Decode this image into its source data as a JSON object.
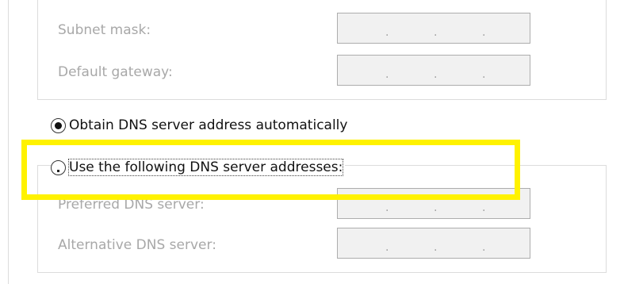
{
  "ip_settings": {
    "subnet_mask": {
      "label": "Subnet mask:",
      "octets": [
        ".",
        ".",
        "."
      ]
    },
    "default_gateway": {
      "label": "Default gateway:",
      "octets": [
        ".",
        ".",
        "."
      ]
    }
  },
  "dns": {
    "obtain_auto": {
      "label": "Obtain DNS server address automatically",
      "selected": true
    },
    "use_following": {
      "label": "Use the following DNS server addresses:",
      "selected": false
    },
    "preferred": {
      "label": "Preferred DNS server:",
      "octets": [
        ".",
        ".",
        "."
      ]
    },
    "alternative": {
      "label": "Alternative DNS server:",
      "octets": [
        ".",
        ".",
        "."
      ]
    }
  },
  "colors": {
    "highlight": "#fff200"
  }
}
